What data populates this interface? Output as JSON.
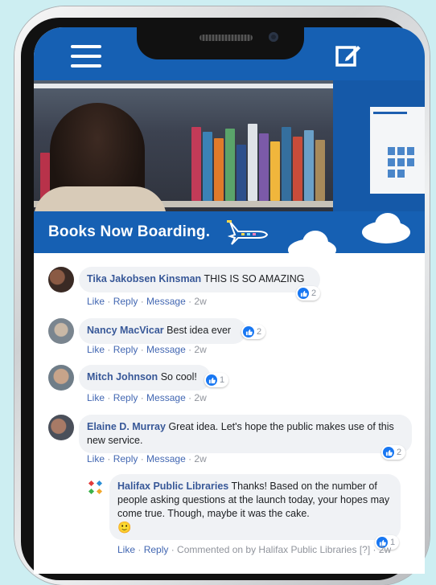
{
  "banner": {
    "title": "Books Now Boarding."
  },
  "comments": [
    {
      "name": "Tika Jakobsen Kinsman",
      "text": "THIS IS SO AMAZING",
      "reactions": "2",
      "time": "2w"
    },
    {
      "name": "Nancy MacVicar",
      "text": "Best idea ever",
      "reactions": "2",
      "time": "2w"
    },
    {
      "name": "Mitch Johnson",
      "text": "So cool!",
      "reactions": "1",
      "time": "2w"
    },
    {
      "name": "Elaine D. Murray",
      "text": "Great idea. Let's hope the public makes use of this new service.",
      "reactions": "2",
      "time": "2w"
    }
  ],
  "reply": {
    "name": "Halifax Public Libraries",
    "text": "Thanks! Based on the number of people asking questions at the launch today, your hopes may come true. Though, maybe it was the cake.",
    "emoji": "🙂",
    "reactions": "1",
    "meta": "Commented on by Halifax Public Libraries [?] · 2w"
  },
  "actions": {
    "like": "Like",
    "reply": "Reply",
    "message": "Message",
    "sep": " · "
  },
  "colors": {
    "brand_blue": "#1660b3",
    "link_blue": "#385898",
    "bubble_bg": "#f0f2f5",
    "like_blue": "#1877f2"
  },
  "icons": [
    "menu-icon",
    "compose-icon",
    "plane-icon",
    "like-icon",
    "library-logo-icon",
    "smile-icon"
  ]
}
